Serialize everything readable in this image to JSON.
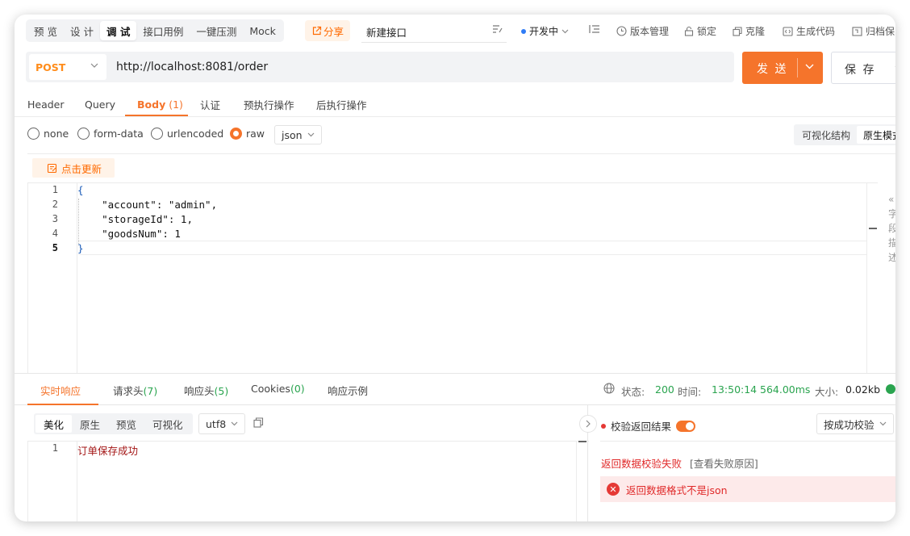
{
  "modes": [
    "预 览",
    "设 计",
    "调 试",
    "接口用例",
    "一键压测",
    "Mock"
  ],
  "active_mode": "调 试",
  "share_label": "分享",
  "tab_name": "新建接口",
  "status_label": "开发中",
  "toolbar": {
    "version": "版本管理",
    "lock": "锁定",
    "clone": "克隆",
    "gen_code": "生成代码",
    "archive": "归档保"
  },
  "request": {
    "method": "POST",
    "url": "http://localhost:8081/order",
    "send_label": "发 送",
    "save_label": "保 存"
  },
  "request_tabs": [
    {
      "label": "Header",
      "count": ""
    },
    {
      "label": "Query",
      "count": ""
    },
    {
      "label": "Body",
      "count": "(1)"
    },
    {
      "label": "认证",
      "count": ""
    },
    {
      "label": "预执行操作",
      "count": ""
    },
    {
      "label": "后执行操作",
      "count": ""
    }
  ],
  "body_types": [
    "none",
    "form-data",
    "urlencoded",
    "raw"
  ],
  "selected_body_type": "raw",
  "format": "json",
  "view_toggle": {
    "visual": "可视化结构",
    "raw": "原生模式"
  },
  "update_label": "点击更新",
  "code_lines": [
    {
      "n": "1",
      "text": "{"
    },
    {
      "n": "2",
      "text": "    \"account\": \"admin\","
    },
    {
      "n": "3",
      "text": "    \"storageId\": 1,"
    },
    {
      "n": "4",
      "text": "    \"goodsNum\": 1"
    },
    {
      "n": "5",
      "text": "}"
    }
  ],
  "side_hint_chars": [
    "«",
    "字",
    "段",
    "描",
    "述"
  ],
  "response_tabs": [
    {
      "label": "实时响应",
      "count": ""
    },
    {
      "label": "请求头",
      "count": "(7)"
    },
    {
      "label": "响应头",
      "count": "(5)"
    },
    {
      "label": "Cookies",
      "count": "(0)"
    },
    {
      "label": "响应示例",
      "count": ""
    }
  ],
  "response_status": {
    "status_label": "状态:",
    "status": "200",
    "time_label": "时间:",
    "time": "13:50:14",
    "duration": "564.00ms",
    "size_label": "大小:",
    "size": "0.02kb"
  },
  "response_views": [
    "美化",
    "原生",
    "预览",
    "可视化"
  ],
  "encoding": "utf8",
  "response_lines": [
    {
      "n": "1",
      "text": "订单保存成功"
    }
  ],
  "validation": {
    "label": "校验返回结果",
    "mode": "按成功校验",
    "fail_text": "返回数据校验失败",
    "fail_link": "[查看失败原因]",
    "error": "返回数据格式不是json"
  },
  "colors": {
    "accent": "#f5742b",
    "success": "#2aa44f",
    "error": "#e02929"
  }
}
